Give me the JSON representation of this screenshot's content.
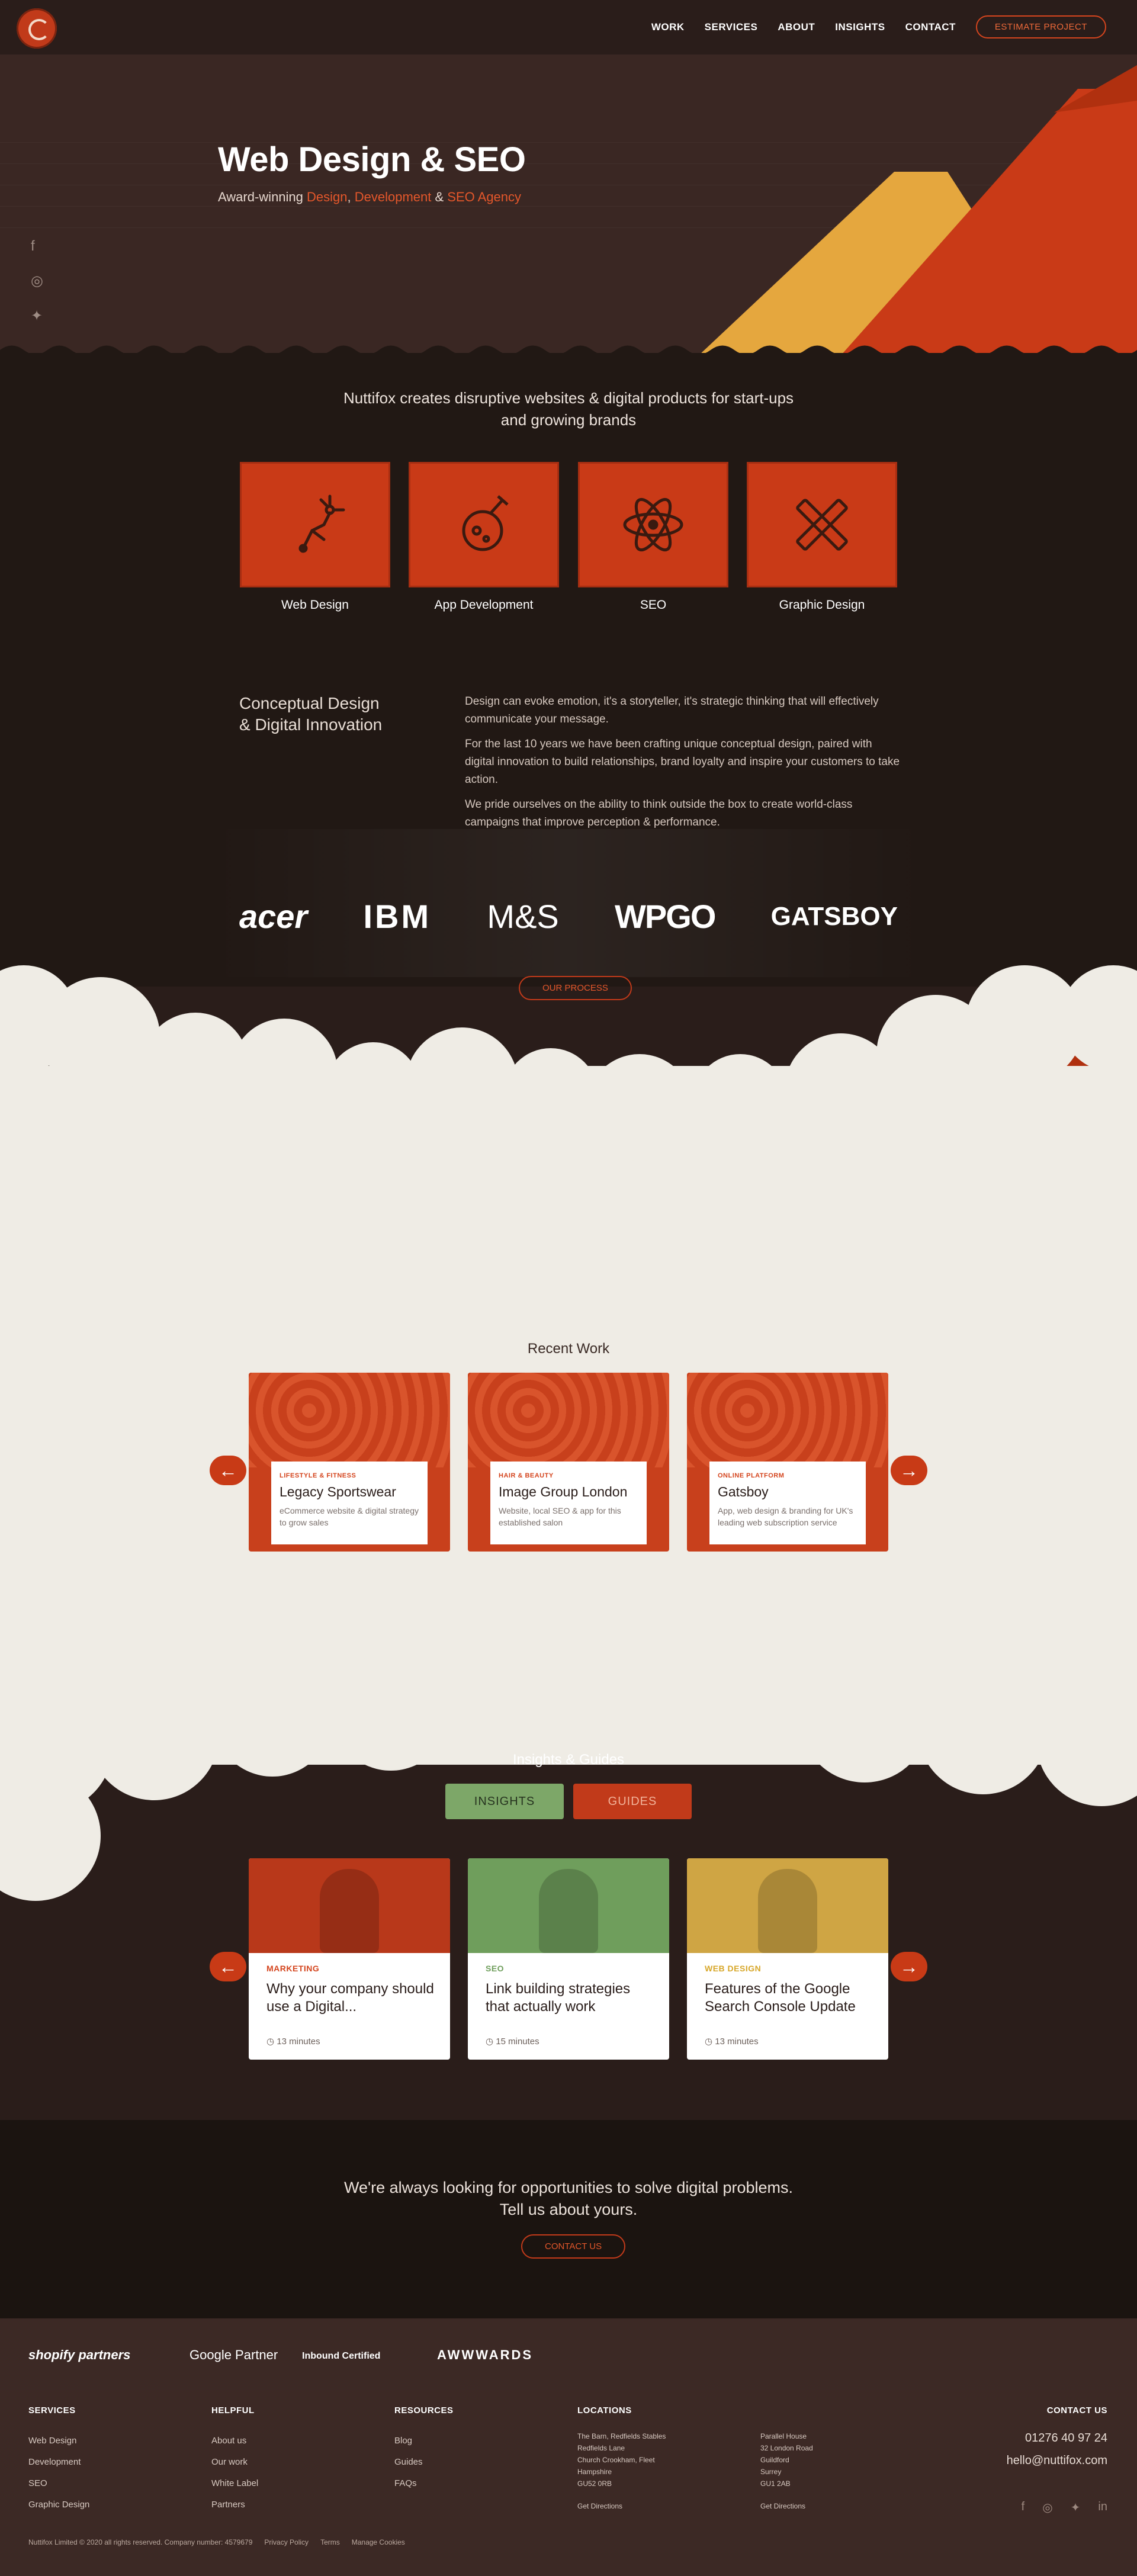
{
  "header": {
    "nav": [
      "WORK",
      "SERVICES",
      "ABOUT",
      "INSIGHTS",
      "CONTACT"
    ],
    "cta": "ESTIMATE PROJECT"
  },
  "hero": {
    "title": "Web Design & SEO",
    "sub_prefix": "Award-winning ",
    "sub_design": "Design",
    "sub_comma": ", ",
    "sub_development": "Development",
    "sub_amp": " & ",
    "sub_seo": "SEO Agency",
    "social_icons": [
      "facebook-icon",
      "instagram-icon",
      "twitter-icon"
    ]
  },
  "intro": {
    "tagline": "Nuttifox creates disruptive websites & digital products for start-ups and growing brands",
    "services": [
      {
        "label": "Web Design",
        "icon": "pen-tool-icon"
      },
      {
        "label": "App Development",
        "icon": "flask-icon"
      },
      {
        "label": "SEO",
        "icon": "atom-icon"
      },
      {
        "label": "Graphic Design",
        "icon": "pencil-ruler-icon"
      }
    ],
    "concept_title_line1": "Conceptual Design",
    "concept_title_line2": "& Digital Innovation",
    "concept_p1": "Design can evoke emotion, it's a storyteller, it's strategic thinking that will effectively communicate your message.",
    "concept_p2": "For the last 10 years we have been crafting unique conceptual design, paired with digital innovation to build relationships, brand loyalty and inspire your customers to take action.",
    "concept_p3": "We pride ourselves on the ability to think outside the box to create world-class campaigns that improve perception & performance.",
    "clients": [
      "acer",
      "IBM",
      "M&S",
      "WPGO",
      "GATSBOY"
    ],
    "process_btn": "OUR PROCESS"
  },
  "recent_work": {
    "title": "Recent Work",
    "items": [
      {
        "category": "LIFESTYLE & FITNESS",
        "name": "Legacy Sportswear",
        "desc": "eCommerce website & digital strategy to grow sales"
      },
      {
        "category": "HAIR & BEAUTY",
        "name": "Image Group London",
        "desc": "Website, local SEO & app for this established salon"
      },
      {
        "category": "ONLINE PLATFORM",
        "name": "Gatsboy",
        "desc": "App, web design & branding for UK's leading web subscription service"
      }
    ],
    "prev_icon": "←",
    "next_icon": "→"
  },
  "insights": {
    "title": "Insights & Guides",
    "tab_insights": "INSIGHTS",
    "tab_guides": "GUIDES",
    "posts": [
      {
        "category": "MARKETING",
        "title": "Why your company should use a Digital...",
        "time": "13 minutes",
        "color": "#d4451e",
        "tint": "#b8381a"
      },
      {
        "category": "SEO",
        "title": "Link building strategies that actually work",
        "time": "15 minutes",
        "color": "#6f9e5c",
        "tint": "#6f9e5c"
      },
      {
        "category": "WEB DESIGN",
        "title": "Features of the Google Search Console Update",
        "time": "13 minutes",
        "color": "#d7a72a",
        "tint": "#cfa544"
      }
    ]
  },
  "cta": {
    "text": "We're always looking for opportunities to solve digital problems. Tell us about yours.",
    "button": "CONTACT US"
  },
  "footer": {
    "partners": [
      "shopify partners",
      "Google Partner",
      "Inbound Certified",
      "AWWWARDS"
    ],
    "services_title": "SERVICES",
    "services": [
      "Web Design",
      "Development",
      "SEO",
      "Graphic Design"
    ],
    "helpful_title": "HELPFUL",
    "helpful": [
      "About us",
      "Our work",
      "White Label",
      "Partners"
    ],
    "resources_title": "RESOURCES",
    "resources": [
      "Blog",
      "Guides",
      "FAQs"
    ],
    "locations_title": "LOCATIONS",
    "loc1": [
      "The Barn, Redfields Stables",
      "Redfields Lane",
      "Church Crookham, Fleet",
      "Hampshire",
      "GU52 0RB"
    ],
    "loc2": [
      "Parallel House",
      "32 London Road",
      "Guildford",
      "Surrey",
      "GU1 2AB"
    ],
    "directions": "Get Directions",
    "contact_title": "CONTACT US",
    "phone": "01276 40 97 24",
    "email": "hello@nuttifox.com",
    "legal": "Nuttifox Limited © 2020 all rights reserved. Company number: 4579679",
    "privacy": "Privacy Policy",
    "terms": "Terms",
    "cookies": "Manage Cookies"
  }
}
